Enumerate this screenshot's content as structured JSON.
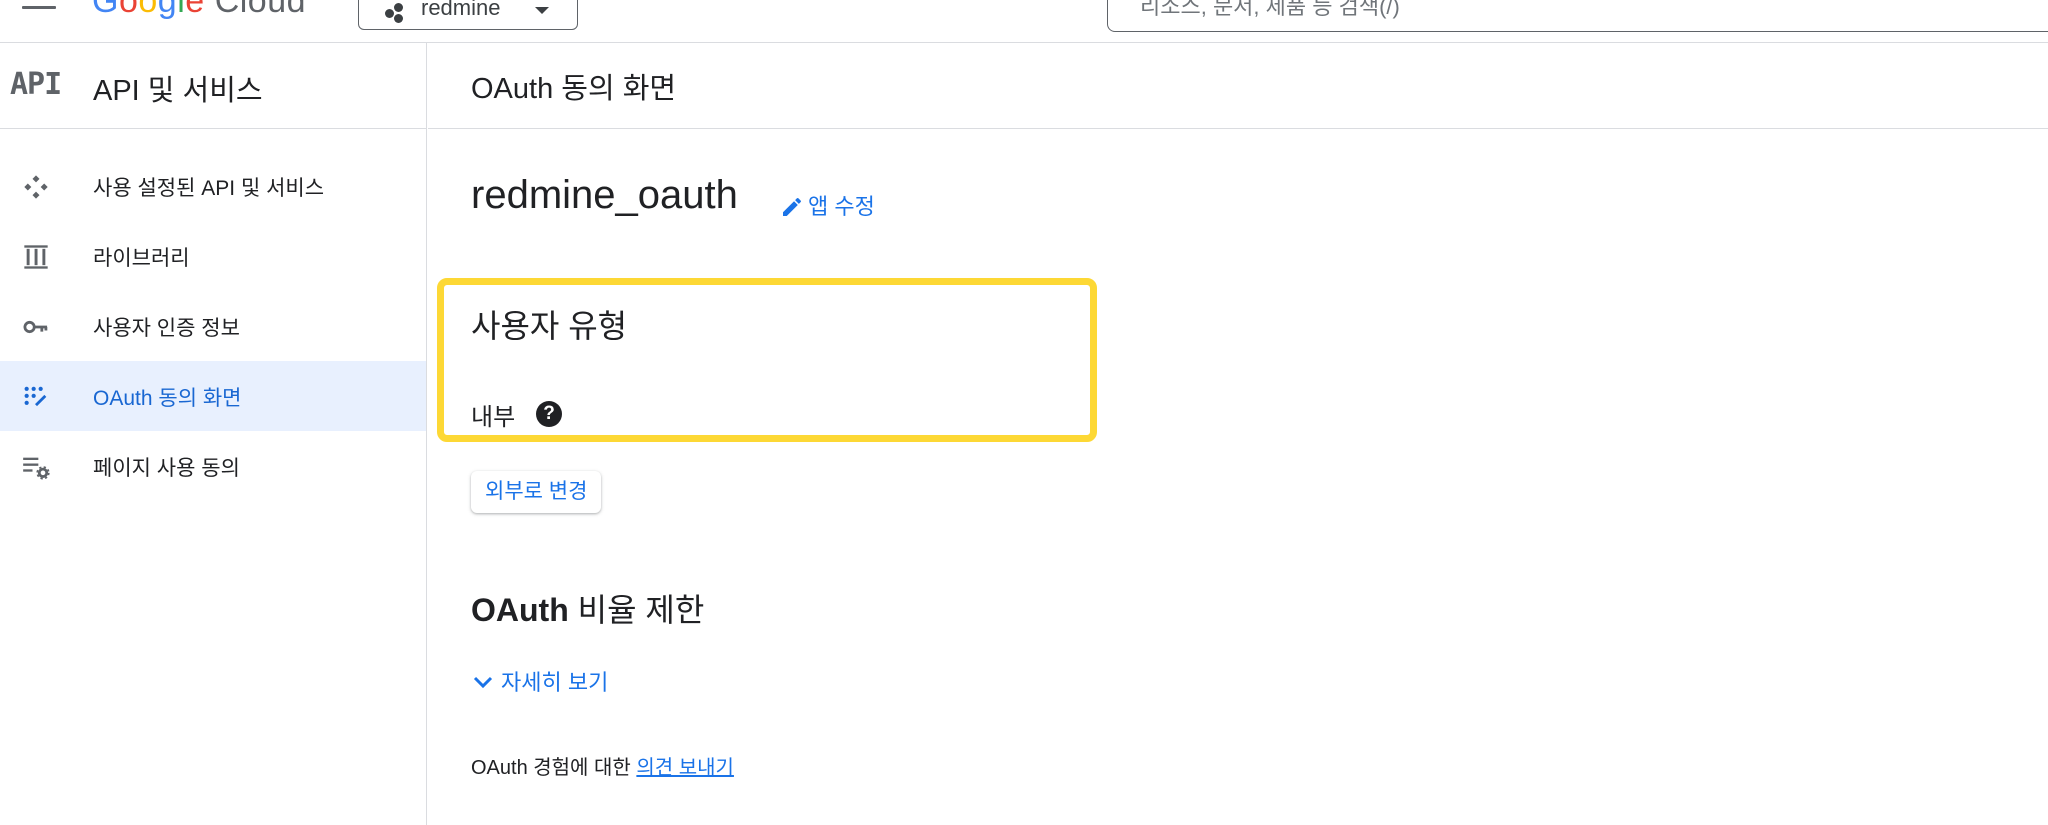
{
  "topbar": {
    "logo_google": [
      "G",
      "o",
      "o",
      "g",
      "l",
      "e"
    ],
    "logo_cloud": "Cloud",
    "project_name": "redmine",
    "search_placeholder": "리소스, 문서, 제품 등 검색(/)"
  },
  "sidebar": {
    "badge": "API",
    "title": "API 및 서비스",
    "items": [
      {
        "label": "사용 설정된 API 및 서비스",
        "icon": "api-services-icon"
      },
      {
        "label": "라이브러리",
        "icon": "library-icon"
      },
      {
        "label": "사용자 인증 정보",
        "icon": "key-icon"
      },
      {
        "label": "OAuth 동의 화면",
        "icon": "oauth-consent-icon",
        "active": true
      },
      {
        "label": "페이지 사용 동의",
        "icon": "page-usage-settings-icon"
      }
    ]
  },
  "main": {
    "page_title": "OAuth 동의 화면",
    "app_name": "redmine_oauth",
    "edit_app_label": "앱 수정",
    "user_type_title": "사용자 유형",
    "user_type_value": "내부",
    "help_glyph": "?",
    "change_button_label": "외부로 변경",
    "rate_limit_title_bold": "OAuth",
    "rate_limit_title_rest": " 비율 제한",
    "details_toggle_label": "자세히 보기",
    "feedback_prefix": "OAuth 경험에 대한 ",
    "feedback_link": "의견 보내기"
  },
  "colors": {
    "accent": "#1a73e8",
    "active_bg": "#e8f0fe",
    "highlight": "#fdd835"
  }
}
